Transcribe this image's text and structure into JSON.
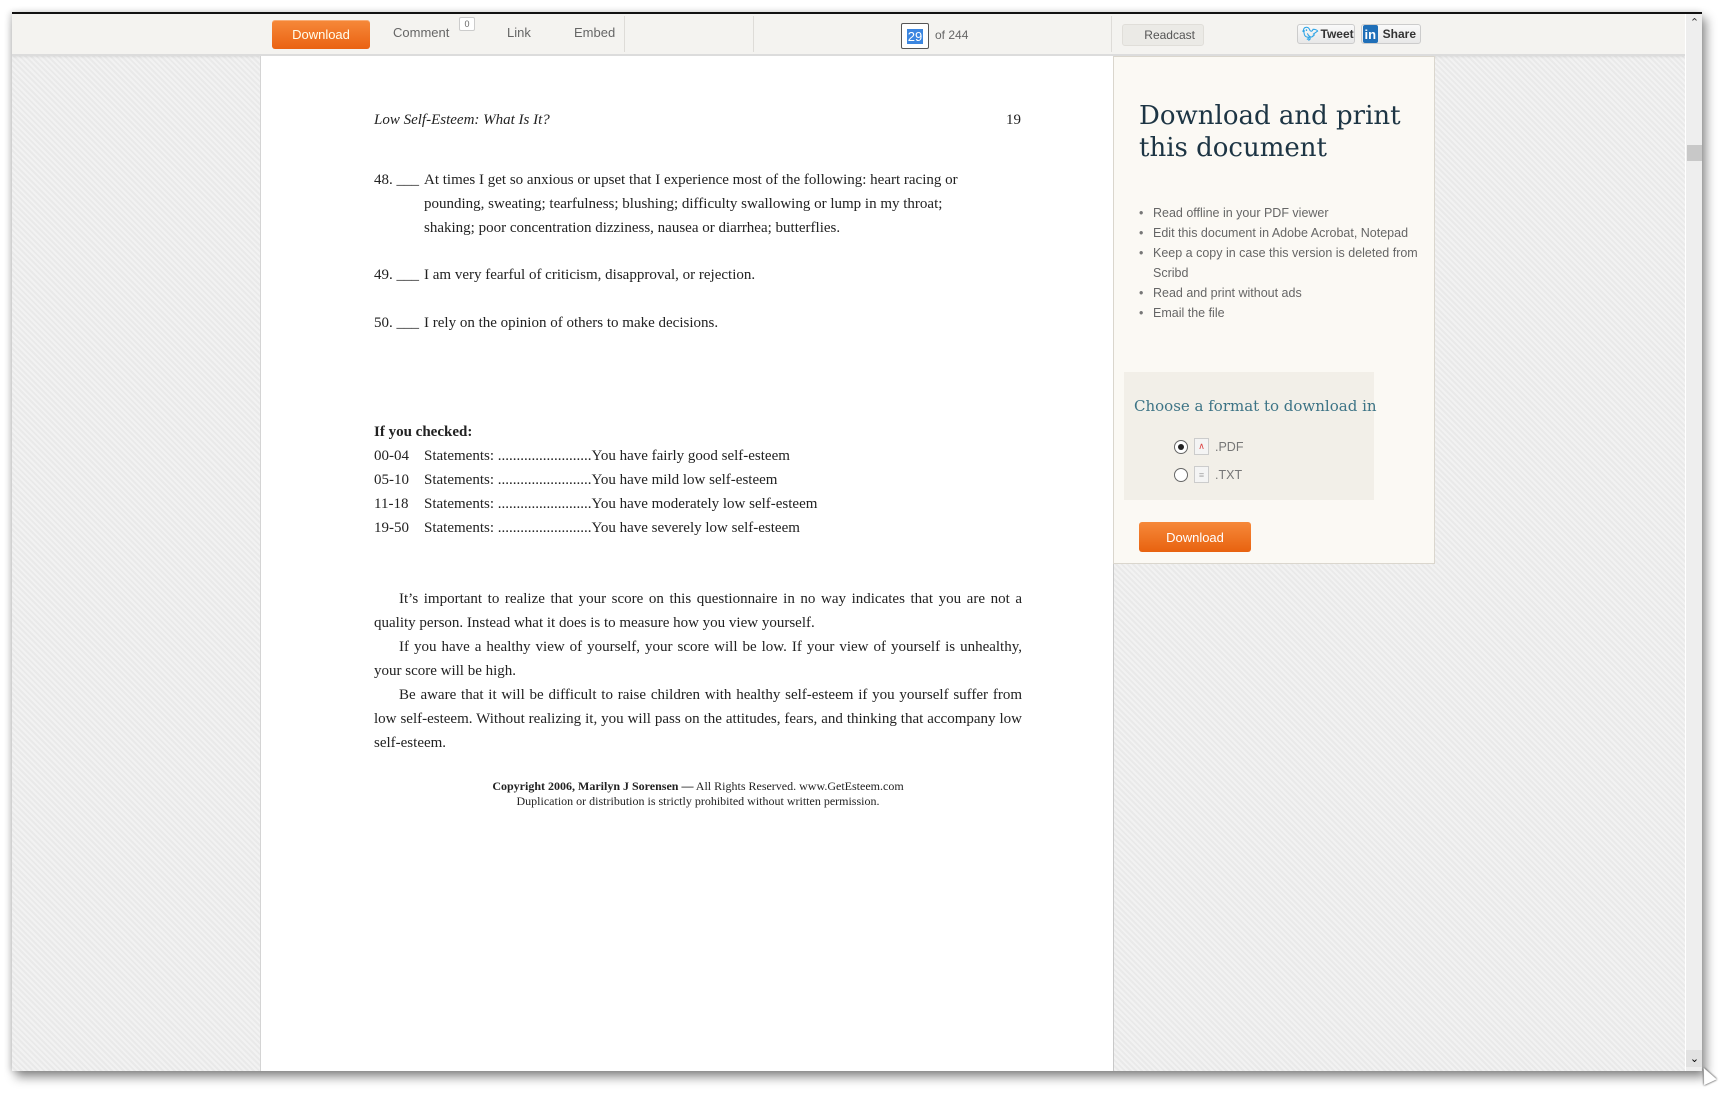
{
  "toolbar": {
    "download_label": "Download",
    "comment_label": "Comment",
    "comment_count": "0",
    "link_label": "Link",
    "embed_label": "Embed",
    "page_current": "29",
    "page_total_label": "of 244",
    "readcast_label": "Readcast",
    "tweet_label": "Tweet",
    "share_label": "Share",
    "accent_color": "#ea6212"
  },
  "document": {
    "running_header": "Low Self-Esteem: What Is It?",
    "page_number": "19",
    "questions": [
      {
        "num": "48. ___",
        "lines": [
          "At times I get so anxious or upset that I experience most of the following: heart racing or",
          "pounding, sweating; tearfulness; blushing; difficulty swallowing or lump in my throat;",
          "shaking; poor concentration dizziness, nausea or diarrhea; butterflies."
        ]
      },
      {
        "num": "49. ___",
        "lines": [
          "I am very fearful of criticism, disapproval, or rejection."
        ]
      },
      {
        "num": "50. ___",
        "lines": [
          "I rely on the opinion of others to make decisions."
        ]
      }
    ],
    "scoring_heading": "If you checked:",
    "scoring": [
      {
        "range": "00-04",
        "text": "Statements: .........................You have fairly good self-esteem"
      },
      {
        "range": "05-10",
        "text": "Statements: .........................You have mild low self-esteem"
      },
      {
        "range": "11-18",
        "text": "Statements: .........................You have moderately low self-esteem"
      },
      {
        "range": "19-50",
        "text": "Statements: .........................You have severely low self-esteem"
      }
    ],
    "paragraphs": [
      "It’s important to realize that your score on this questionnaire in no way indicates that you are not a quality person. Instead what it does is to measure how you view yourself.",
      "If you have a healthy view of yourself, your score will be low. If your view of yourself is unhealthy, your score will be high.",
      "Be aware that it will be difficult to raise children with healthy self-esteem if you yourself suffer from low self-esteem. Without realizing it, you will pass on the attitudes, fears, and thinking that accompany low self-esteem."
    ],
    "copyright_bold": "Copyright 2006, Marilyn J Sorensen —",
    "copyright_rest": " All Rights Reserved. www.GetEsteem.com",
    "copyright_line2": "Duplication or distribution is strictly prohibited without written permission."
  },
  "sidebar": {
    "title": "Download and print this document",
    "benefits": [
      "Read offline in your PDF viewer",
      "Edit this document in Adobe Acrobat, Notepad",
      "Keep a copy in case this version is deleted from Scribd",
      "Read and print without ads",
      "Email the file"
    ],
    "format_title": "Choose a format to download in",
    "formats": [
      {
        "label": ".PDF",
        "selected": true,
        "icon": "pdf-file-icon"
      },
      {
        "label": ".TXT",
        "selected": false,
        "icon": "text-file-icon"
      }
    ],
    "download_label": "Download"
  }
}
